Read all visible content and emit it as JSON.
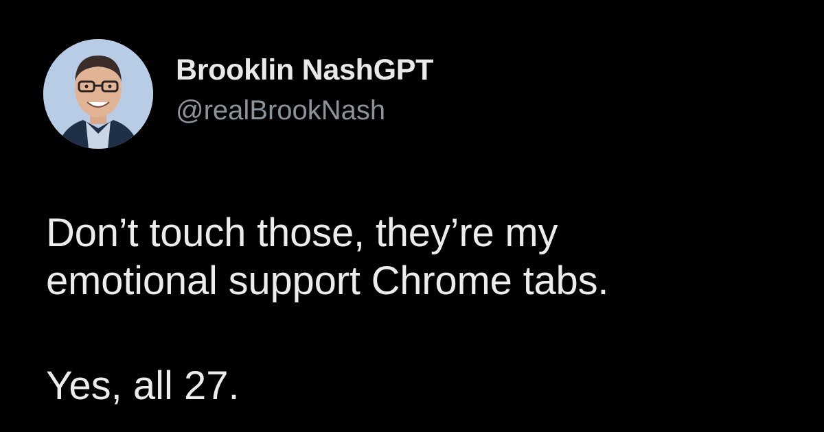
{
  "tweet": {
    "author": {
      "display_name": "Brooklin NashGPT",
      "handle": "@realBrookNash",
      "avatar_icon": "person-portrait-avatar"
    },
    "text": {
      "line1": "Don’t touch those, they’re my",
      "line2": "emotional support Chrome tabs.",
      "line3": "Yes, all 27."
    }
  },
  "colors": {
    "background": "#000000",
    "primary_text": "#e7e9ea",
    "secondary_text": "#8b949b",
    "avatar_bg": "#b9cce6"
  }
}
